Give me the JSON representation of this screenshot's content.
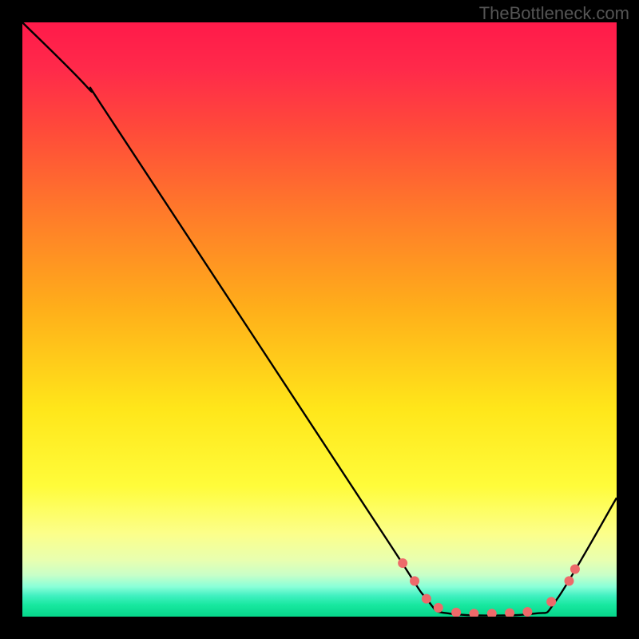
{
  "watermark": "TheBottleneck.com",
  "chart_data": {
    "type": "line",
    "title": "",
    "xlabel": "",
    "ylabel": "",
    "xlim": [
      0,
      100
    ],
    "ylim": [
      0,
      100
    ],
    "curve": {
      "name": "bottleneck-curve",
      "points": [
        {
          "x": 0,
          "y": 100
        },
        {
          "x": 11,
          "y": 89
        },
        {
          "x": 16,
          "y": 82
        },
        {
          "x": 60,
          "y": 15
        },
        {
          "x": 68,
          "y": 3
        },
        {
          "x": 72,
          "y": 0.5
        },
        {
          "x": 86,
          "y": 0.5
        },
        {
          "x": 90,
          "y": 3
        },
        {
          "x": 100,
          "y": 20
        }
      ]
    },
    "markers": {
      "name": "highlight-dots",
      "color": "#ed6a6a",
      "radius": 6,
      "points": [
        {
          "x": 64,
          "y": 9
        },
        {
          "x": 66,
          "y": 6
        },
        {
          "x": 68,
          "y": 3
        },
        {
          "x": 70,
          "y": 1.5
        },
        {
          "x": 73,
          "y": 0.7
        },
        {
          "x": 76,
          "y": 0.5
        },
        {
          "x": 79,
          "y": 0.5
        },
        {
          "x": 82,
          "y": 0.6
        },
        {
          "x": 85,
          "y": 0.8
        },
        {
          "x": 89,
          "y": 2.5
        },
        {
          "x": 92,
          "y": 6
        },
        {
          "x": 93,
          "y": 8
        }
      ]
    },
    "gradient_stops": [
      {
        "pos": 0,
        "color": "#ff1a4a"
      },
      {
        "pos": 0.5,
        "color": "#ffe61a"
      },
      {
        "pos": 0.9,
        "color": "#e8ffb0"
      },
      {
        "pos": 1.0,
        "color": "#06d68a"
      }
    ]
  }
}
